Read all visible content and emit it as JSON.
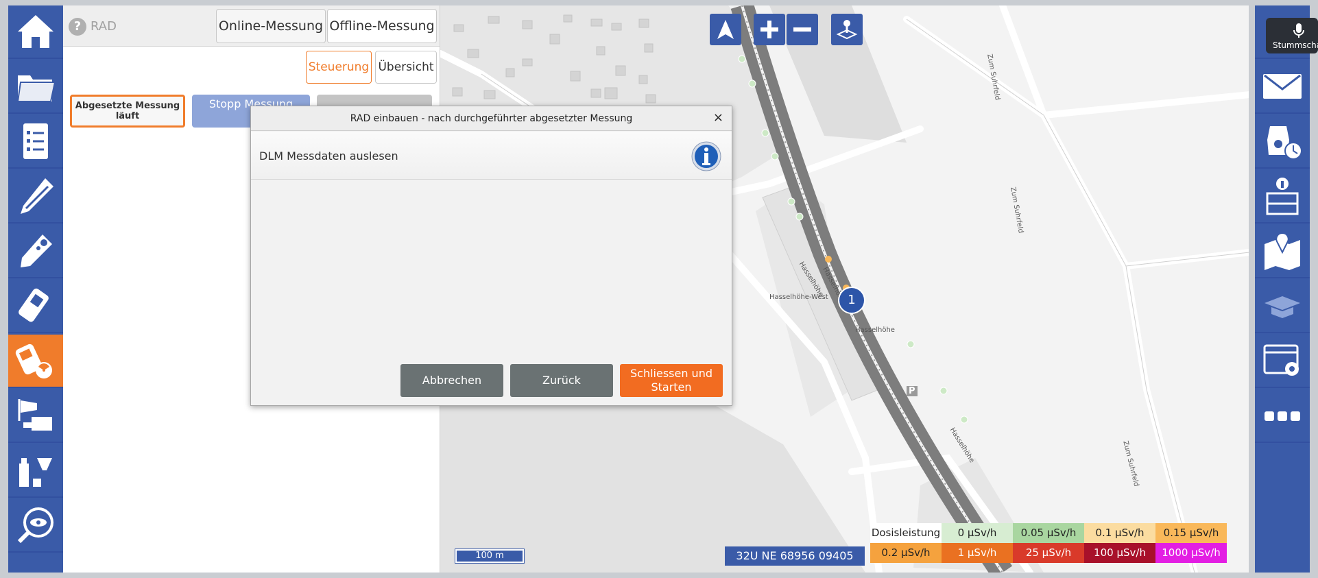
{
  "panel": {
    "title": "RAD",
    "mode_tabs": [
      "Online-Messung",
      "Offline-Messung"
    ],
    "view_tabs": [
      "Steuerung",
      "Übersicht"
    ],
    "status_text": "Abgesetzte Messung läuft",
    "stop_button_label": "Stopp Messung"
  },
  "tooltip": {
    "text": "Stummschalten"
  },
  "dialog": {
    "title": "RAD einbauen - nach durchgeführter abgesetzter Messung",
    "close_glyph": "×",
    "subtitle": "DLM Messdaten auslesen",
    "buttons": {
      "cancel": "Abbrechen",
      "back": "Zurück",
      "confirm": "Schliessen und Starten"
    }
  },
  "map": {
    "scale_label": "100 m",
    "coordinates": "32U NE 68956 09405",
    "poi_number": "1",
    "labels": {
      "station_west": "Hasselhöhe-West",
      "station": "Hasselhöhe",
      "street_1": "Hasselhöhe",
      "street_2": "Hasselhöhe",
      "street_3": "Hasselhöhe",
      "suhrfeld_1": "Zum Suhrfeld",
      "suhrfeld_2": "Zum Suhrfeld",
      "suhrfeld_3": "Zum Suhrfeld",
      "parking": "P"
    }
  },
  "legend": {
    "title": "Dosisleistung",
    "items": [
      {
        "label": "0 µSv/h",
        "color": "#d7edd2"
      },
      {
        "label": "0.05 µSv/h",
        "color": "#a9d6a0"
      },
      {
        "label": "0.1 µSv/h",
        "color": "#fbdca0"
      },
      {
        "label": "0.15 µSv/h",
        "color": "#f9b85a"
      },
      {
        "label": "0.2 µSv/h",
        "color": "#f5a23e"
      },
      {
        "label": "1 µSv/h",
        "color": "#ea7121"
      },
      {
        "label": "25 µSv/h",
        "color": "#d93a2a"
      },
      {
        "label": "100 µSv/h",
        "color": "#a8102a"
      },
      {
        "label": "1000 µSv/h",
        "color": "#e31ee3"
      }
    ]
  },
  "colors": {
    "accent": "#f07c2b",
    "primary": "#3a5ba8",
    "dialog_button": "#6a7273"
  },
  "icons": {
    "left_nav": [
      "home-icon",
      "folder-icon",
      "checklist-icon",
      "probe-icon",
      "dosimeter-icon",
      "handheld-meter-icon",
      "radiation-meter-icon",
      "windsock-icon",
      "sampling-icon",
      "eye-search-icon"
    ],
    "right_nav": [
      "microphone-icon",
      "mail-icon",
      "mask-timer-icon",
      "info-grid-icon",
      "map-pin-icon",
      "training-cap-icon",
      "settings-window-icon",
      "more-icon"
    ],
    "map_tools": [
      "north-arrow-icon",
      "zoom-in-icon",
      "zoom-out-icon",
      "joystick-icon"
    ]
  }
}
